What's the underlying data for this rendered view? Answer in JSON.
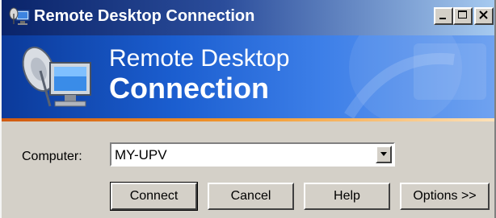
{
  "window": {
    "title": "Remote Desktop Connection",
    "title_icon": "remote-desktop-icon",
    "controls": [
      "minimize-icon",
      "maximize-icon",
      "close-icon"
    ]
  },
  "banner": {
    "line1": "Remote Desktop",
    "line2": "Connection",
    "graphic": "computer-satellite-icon"
  },
  "form": {
    "computer_label": "Computer:",
    "computer_value": "MY-UPV"
  },
  "buttons": {
    "connect": "Connect",
    "cancel": "Cancel",
    "help": "Help",
    "options": "Options >>"
  },
  "colors": {
    "titlebar_start": "#0a246a",
    "banner_blue": "#1b5ed0",
    "accent_orange": "#f39a2e",
    "dialog_bg": "#d4d0c8"
  }
}
